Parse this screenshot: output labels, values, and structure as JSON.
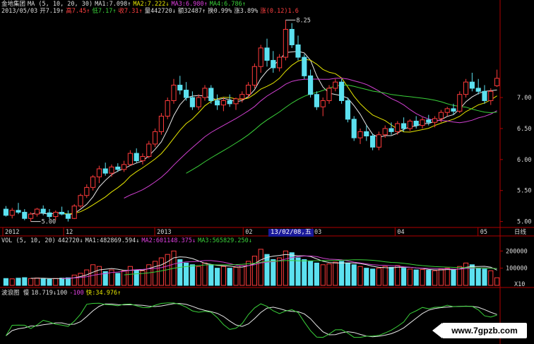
{
  "header": {
    "row1": [
      {
        "t": "金地集团",
        "c": "w"
      },
      {
        "t": "MA (5, 10, 20, 30)",
        "c": "w"
      },
      {
        "t": "MA1:7.098↑",
        "c": "w"
      },
      {
        "t": "MA2:7.222↓",
        "c": "y"
      },
      {
        "t": "MA3:6.980↑",
        "c": "m"
      },
      {
        "t": "MA4:6.786↑",
        "c": "g"
      }
    ],
    "row2": [
      {
        "t": "2013/05/03",
        "c": "w"
      },
      {
        "t": "开7.19↑",
        "c": "w"
      },
      {
        "t": "高7.45↑",
        "c": "r"
      },
      {
        "t": "低7.17↑",
        "c": "g"
      },
      {
        "t": "收7.31↑",
        "c": "r"
      },
      {
        "t": "量442720↓",
        "c": "w"
      },
      {
        "t": "额32487↑",
        "c": "w"
      },
      {
        "t": "换0.99%",
        "c": "w"
      },
      {
        "t": "涨3.89%",
        "c": "w"
      },
      {
        "t": "涨(0.12)1.6",
        "c": "r"
      }
    ]
  },
  "price_axis": [
    "7.00",
    "6.50",
    "6.00",
    "5.50",
    "5.00"
  ],
  "time_axis": [
    "2012",
    "12",
    "2013",
    "02",
    "03",
    "04",
    "05"
  ],
  "time_axis_unit": "日线",
  "cursor_date": "13/02/08,五",
  "annotations": {
    "high": "8.25",
    "low": "5.00"
  },
  "volume_header": [
    {
      "t": "VOL (5, 10, 20)",
      "c": "w"
    },
    {
      "t": "442720↓",
      "c": "w"
    },
    {
      "t": "MA1:482869.594↓",
      "c": "w"
    },
    {
      "t": "MA2:601148.375↓",
      "c": "m"
    },
    {
      "t": "MA3:565829.250↓",
      "c": "g"
    }
  ],
  "volume_axis": [
    "200000",
    "100000"
  ],
  "volume_unit": "X10",
  "wave_header": [
    {
      "t": "波浪图 慢",
      "c": "w"
    },
    {
      "t": "18.719↓100",
      "c": "w"
    },
    {
      "t": "-100",
      "c": "m"
    },
    {
      "t": "快:34.976↑",
      "c": "y"
    }
  ],
  "watermark": "www.7gpzb.com",
  "colors": {
    "up": "#ff3b3b",
    "down": "#5ce1f0",
    "ma5": "#e8e8e8",
    "ma10": "#e6e600",
    "ma20": "#d040d0",
    "ma30": "#3ad13a"
  },
  "chart_data": {
    "type": "candlestick",
    "price_range": [
      4.95,
      8.3
    ],
    "volume_range": [
      0,
      230000
    ],
    "candles": [
      [
        5.2,
        5.25,
        5.08,
        5.1
      ],
      [
        5.1,
        5.22,
        5.05,
        5.18
      ],
      [
        5.18,
        5.3,
        5.12,
        5.15
      ],
      [
        5.15,
        5.2,
        5.02,
        5.05
      ],
      [
        5.05,
        5.15,
        5.0,
        5.12
      ],
      [
        5.12,
        5.22,
        5.08,
        5.2
      ],
      [
        5.2,
        5.26,
        5.1,
        5.14
      ],
      [
        5.14,
        5.2,
        5.04,
        5.08
      ],
      [
        5.08,
        5.18,
        5.02,
        5.15
      ],
      [
        5.15,
        5.24,
        5.1,
        5.12
      ],
      [
        5.12,
        5.18,
        5.0,
        5.05
      ],
      [
        5.05,
        5.28,
        5.04,
        5.25
      ],
      [
        5.25,
        5.45,
        5.22,
        5.42
      ],
      [
        5.42,
        5.6,
        5.38,
        5.55
      ],
      [
        5.55,
        5.75,
        5.5,
        5.72
      ],
      [
        5.72,
        5.9,
        5.62,
        5.85
      ],
      [
        5.85,
        5.95,
        5.74,
        5.78
      ],
      [
        5.78,
        5.92,
        5.72,
        5.88
      ],
      [
        5.88,
        5.94,
        5.8,
        5.84
      ],
      [
        5.84,
        5.98,
        5.8,
        5.92
      ],
      [
        5.92,
        6.15,
        5.9,
        6.1
      ],
      [
        6.1,
        6.18,
        5.95,
        5.98
      ],
      [
        5.98,
        6.1,
        5.92,
        6.05
      ],
      [
        6.05,
        6.3,
        6.02,
        6.25
      ],
      [
        6.25,
        6.5,
        6.2,
        6.45
      ],
      [
        6.45,
        6.75,
        6.4,
        6.7
      ],
      [
        6.7,
        7.0,
        6.65,
        6.95
      ],
      [
        6.95,
        7.3,
        6.9,
        7.2
      ],
      [
        7.2,
        7.35,
        7.05,
        7.12
      ],
      [
        7.12,
        7.25,
        6.95,
        7.0
      ],
      [
        7.0,
        7.1,
        6.8,
        6.85
      ],
      [
        6.85,
        7.05,
        6.8,
        7.0
      ],
      [
        7.0,
        7.2,
        6.95,
        7.15
      ],
      [
        7.15,
        7.2,
        6.9,
        6.95
      ],
      [
        6.95,
        7.05,
        6.8,
        6.88
      ],
      [
        6.88,
        7.0,
        6.78,
        6.95
      ],
      [
        6.95,
        7.05,
        6.85,
        6.9
      ],
      [
        6.9,
        7.0,
        6.8,
        6.98
      ],
      [
        6.98,
        7.1,
        6.92,
        7.05
      ],
      [
        7.05,
        7.25,
        7.0,
        7.2
      ],
      [
        7.2,
        7.55,
        7.15,
        7.5
      ],
      [
        7.5,
        7.85,
        7.4,
        7.8
      ],
      [
        7.8,
        7.95,
        7.5,
        7.6
      ],
      [
        7.6,
        7.75,
        7.4,
        7.48
      ],
      [
        7.48,
        7.7,
        7.42,
        7.65
      ],
      [
        7.65,
        8.25,
        7.6,
        8.1
      ],
      [
        8.1,
        8.2,
        7.8,
        7.85
      ],
      [
        7.85,
        8.0,
        7.6,
        7.65
      ],
      [
        7.65,
        7.7,
        7.3,
        7.35
      ],
      [
        7.35,
        7.45,
        7.0,
        7.05
      ],
      [
        7.05,
        7.1,
        6.8,
        6.85
      ],
      [
        6.85,
        7.0,
        6.7,
        6.95
      ],
      [
        6.95,
        7.2,
        6.9,
        7.15
      ],
      [
        7.15,
        7.3,
        7.1,
        7.25
      ],
      [
        7.25,
        7.3,
        6.9,
        6.95
      ],
      [
        6.95,
        7.0,
        6.6,
        6.65
      ],
      [
        6.65,
        6.7,
        6.3,
        6.35
      ],
      [
        6.35,
        6.5,
        6.25,
        6.45
      ],
      [
        6.45,
        6.55,
        6.3,
        6.38
      ],
      [
        6.38,
        6.42,
        6.15,
        6.2
      ],
      [
        6.2,
        6.45,
        6.15,
        6.4
      ],
      [
        6.4,
        6.55,
        6.35,
        6.5
      ],
      [
        6.5,
        6.6,
        6.4,
        6.45
      ],
      [
        6.45,
        6.62,
        6.4,
        6.58
      ],
      [
        6.58,
        6.68,
        6.45,
        6.5
      ],
      [
        6.5,
        6.65,
        6.46,
        6.62
      ],
      [
        6.62,
        6.7,
        6.5,
        6.55
      ],
      [
        6.55,
        6.68,
        6.5,
        6.64
      ],
      [
        6.64,
        6.72,
        6.55,
        6.6
      ],
      [
        6.6,
        6.7,
        6.52,
        6.66
      ],
      [
        6.66,
        6.8,
        6.6,
        6.76
      ],
      [
        6.76,
        6.85,
        6.7,
        6.82
      ],
      [
        6.82,
        6.9,
        6.72,
        6.78
      ],
      [
        6.78,
        7.1,
        6.75,
        7.05
      ],
      [
        7.05,
        7.3,
        7.0,
        7.25
      ],
      [
        7.25,
        7.4,
        7.1,
        7.15
      ],
      [
        7.15,
        7.3,
        7.05,
        7.1
      ],
      [
        7.1,
        7.2,
        6.9,
        6.95
      ],
      [
        6.95,
        7.15,
        6.88,
        7.1
      ],
      [
        7.19,
        7.45,
        7.17,
        7.31
      ]
    ],
    "volumes": [
      40000,
      38000,
      42000,
      45000,
      40000,
      43000,
      38000,
      36000,
      40000,
      42000,
      44000,
      60000,
      70000,
      90000,
      120000,
      110000,
      80000,
      90000,
      70000,
      85000,
      110000,
      90000,
      85000,
      120000,
      140000,
      160000,
      180000,
      200000,
      150000,
      130000,
      120000,
      110000,
      130000,
      120000,
      100000,
      110000,
      100000,
      105000,
      115000,
      140000,
      170000,
      210000,
      180000,
      150000,
      160000,
      200000,
      190000,
      160000,
      150000,
      140000,
      130000,
      120000,
      125000,
      135000,
      140000,
      130000,
      120000,
      110000,
      100000,
      95000,
      100000,
      110000,
      105000,
      115000,
      100000,
      95000,
      90000,
      92000,
      88000,
      85000,
      95000,
      100000,
      90000,
      110000,
      130000,
      120000,
      100000,
      95000,
      85000,
      44272
    ]
  }
}
